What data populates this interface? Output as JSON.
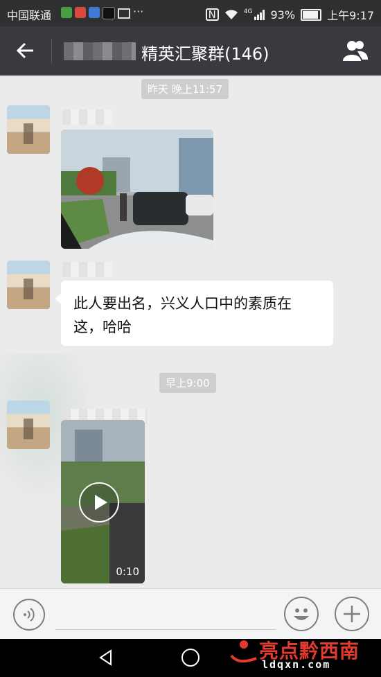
{
  "status_bar": {
    "carrier": "中国联通",
    "network": "4G",
    "battery": "93%",
    "time": "上午9:17",
    "battery_level": 0.93
  },
  "header": {
    "title": "精英汇聚群(146)"
  },
  "messages": [
    {
      "type": "time",
      "text": "昨天 晚上11:57"
    },
    {
      "type": "image"
    },
    {
      "type": "text",
      "text": "此人要出名，兴义人口中的素质在这，哈哈"
    },
    {
      "type": "time",
      "text": "早上9:00"
    },
    {
      "type": "video",
      "duration": "0:10"
    }
  ],
  "message_lines": [
    "此人要出名，兴义人口中的素质在",
    "这，哈哈"
  ],
  "watermark": {
    "main": "亮点黔西南",
    "sub": "ldqxn.com"
  },
  "colors": {
    "title_bar": "#393a3f",
    "status_bar": "#2f3031",
    "chat_background": "#ebebeb",
    "watermark_red": "#e33b2e"
  }
}
